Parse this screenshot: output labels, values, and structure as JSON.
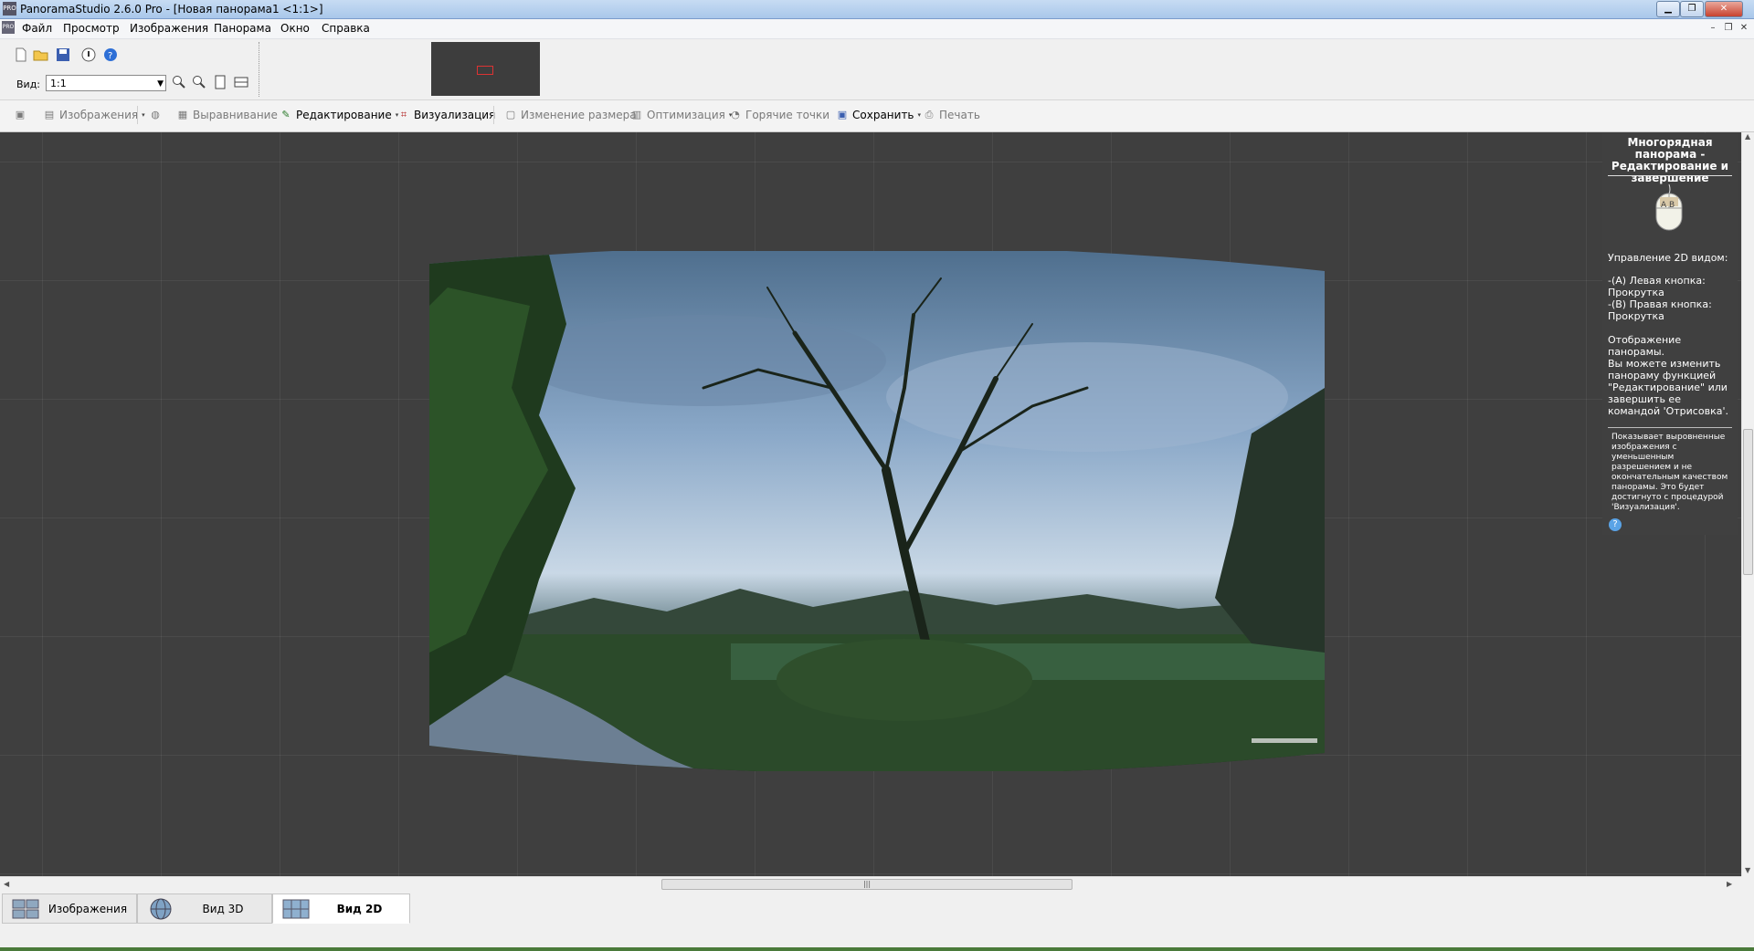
{
  "window": {
    "title": "PanoramaStudio 2.6.0 Pro - [Новая панорама1 <1:1>]",
    "app_icon_text": "PRO"
  },
  "menu": {
    "items": [
      "Файл",
      "Просмотр",
      "Изображения",
      "Панорама",
      "Окно",
      "Справка"
    ]
  },
  "toolbar": {
    "icons": [
      "new-file-icon",
      "open-folder-icon",
      "save-icon",
      "info-icon",
      "help-icon"
    ],
    "view_label": "Вид:",
    "view_value": "1:1",
    "zoom_icons": [
      "zoom-in-icon",
      "zoom-out-icon",
      "zoom-fit-height-icon",
      "zoom-fit-window-icon"
    ]
  },
  "workflow": {
    "images": "Изображения",
    "align": "Выравнивание",
    "edit": "Редактирование",
    "visualize": "Визуализация",
    "resize": "Изменение размера",
    "optimize": "Оптимизация",
    "hotspots": "Горячие точки",
    "save": "Сохранить",
    "print": "Печать"
  },
  "help": {
    "title": "Многорядная панорама - Редактирование и завершение",
    "mouse_label": "A B",
    "control_title": "Управление 2D видом:",
    "control_body": "-(A) Левая кнопка: Прокрутка\n-(B) Правая кнопка: Прокрутка",
    "display": "Отображение панорамы.",
    "edit_hint": "Вы можете изменить панораму функцией \"Редактирование\" или завершить ее командой 'Отрисовка'.",
    "note": "Показывает выровненные изображения с уменьшенным разрешением и не окончательным качеством панорамы. Это будет достигнуто с процедурой 'Визуализация'."
  },
  "tabs": [
    {
      "label": "Изображения",
      "active": false
    },
    {
      "label": "Вид 3D",
      "active": false
    },
    {
      "label": "Вид 2D",
      "active": true
    }
  ],
  "colors": {
    "canvas_bg": "#3f3f3f",
    "panel_bg": "#404040",
    "title_bar": "#a9c7ea"
  }
}
